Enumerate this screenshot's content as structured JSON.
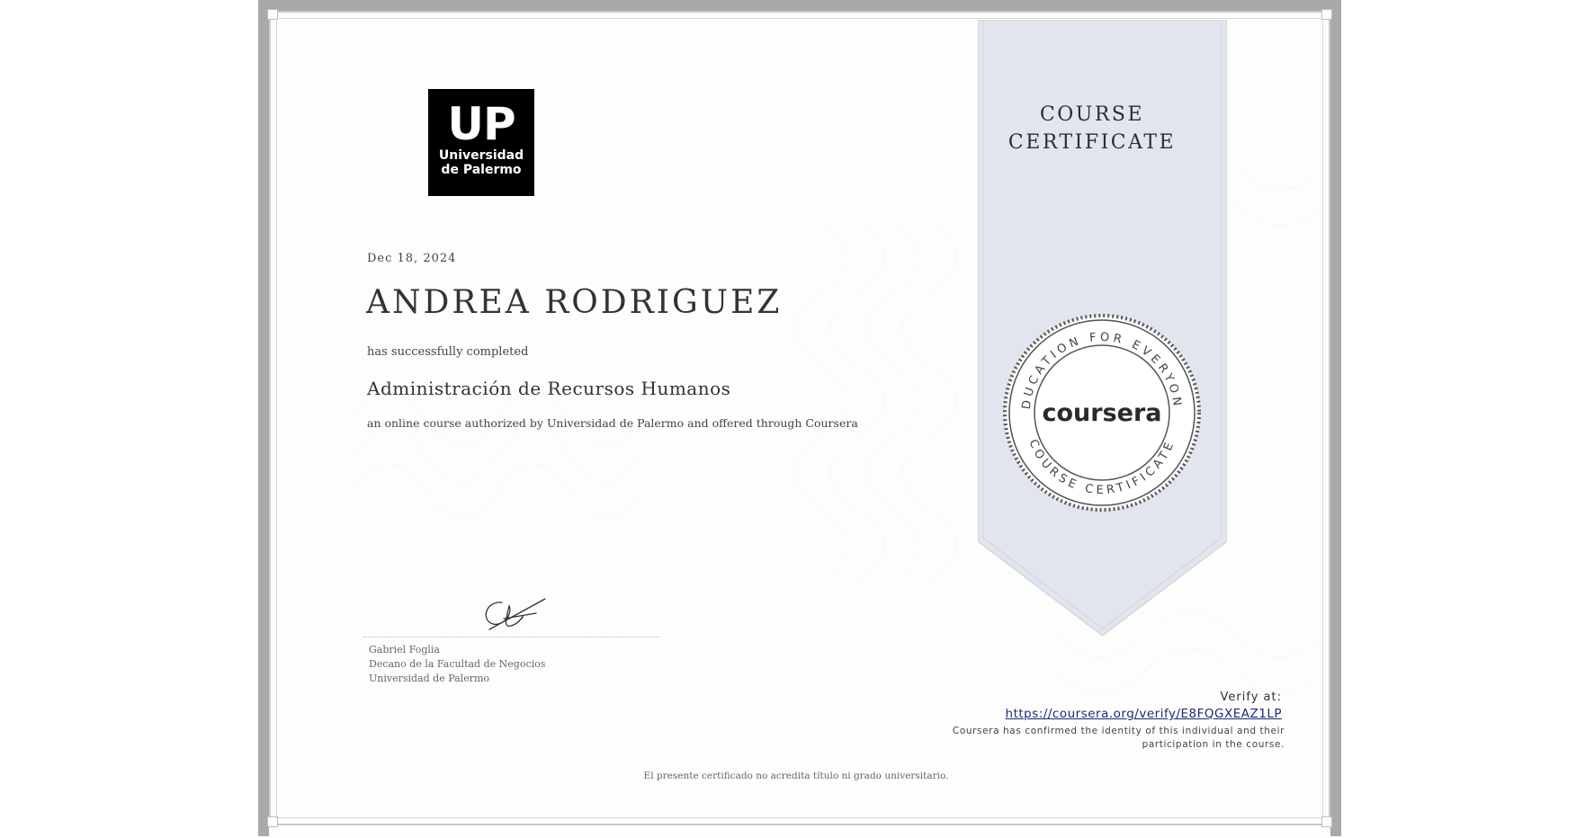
{
  "certificate": {
    "ribbon_title_line1": "COURSE",
    "ribbon_title_line2": "CERTIFICATE",
    "logo": {
      "big": "UP",
      "line1": "Universidad",
      "line2": "de Palermo"
    },
    "date": "Dec 18, 2024",
    "recipient_name": "ANDREA RODRIGUEZ",
    "completed_text": "has successfully completed",
    "course_title": "Administración de Recursos Humanos",
    "authorized_text": "an online course authorized by Universidad de Palermo and offered through Coursera",
    "signer": {
      "name": "Gabriel Foglia",
      "title": "Decano de la Facultad de Negocios",
      "institution": "Universidad de Palermo"
    },
    "seal": {
      "brand": "coursera",
      "top_text": "EDUCATION FOR EVERYONE",
      "bottom_text": "COURSE CERTIFICATE"
    },
    "verify": {
      "label": "Verify at:",
      "url": "https://coursera.org/verify/E8FQGXEAZ1LP",
      "note_line1": "Coursera has confirmed the identity of this individual and their",
      "note_line2": "participation in the course."
    },
    "disclaimer": "El presente certificado no acredita título ni grado universitario."
  },
  "colors": {
    "frame_gray": "#a9a9ab",
    "ribbon_fill": "#e1e6ee",
    "link_blue": "#1a2a7a"
  }
}
